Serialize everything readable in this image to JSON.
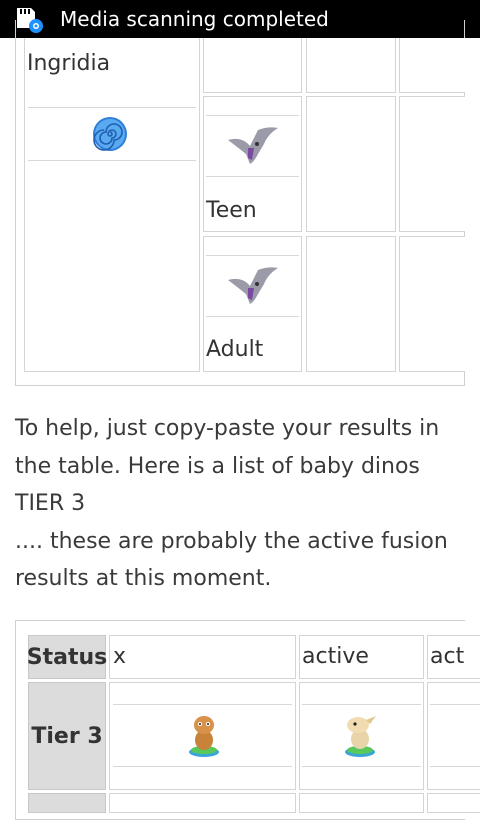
{
  "status_bar": {
    "notification": "Media scanning completed",
    "icon": "sd-card-scan-icon"
  },
  "top_table": {
    "name": "Ingridia",
    "swirl_icon": "blue-swirl-icon",
    "stages": [
      {
        "label": "Teen",
        "image": "pterodactyl-dino-icon"
      },
      {
        "label": "Adult",
        "image": "pterodactyl-dino-icon"
      }
    ]
  },
  "paragraph": {
    "line1": "To help, just copy-paste your results in",
    "line2": "the table. Here is a list of baby dinos",
    "line3": "TIER 3",
    "line4": ".... these are probably the active fusion",
    "line5": "results at this moment."
  },
  "bottom_table": {
    "headers": [
      "Status",
      "x",
      "active",
      "act"
    ],
    "row_label": "Tier 3",
    "row_images": [
      "orange-baby-dino-icon",
      "beige-baby-dino-icon"
    ]
  },
  "colors": {
    "status_bar_bg": "#000000",
    "header_cell_bg": "#dcdcdc",
    "swirl_blue": "#3a8ee8"
  }
}
